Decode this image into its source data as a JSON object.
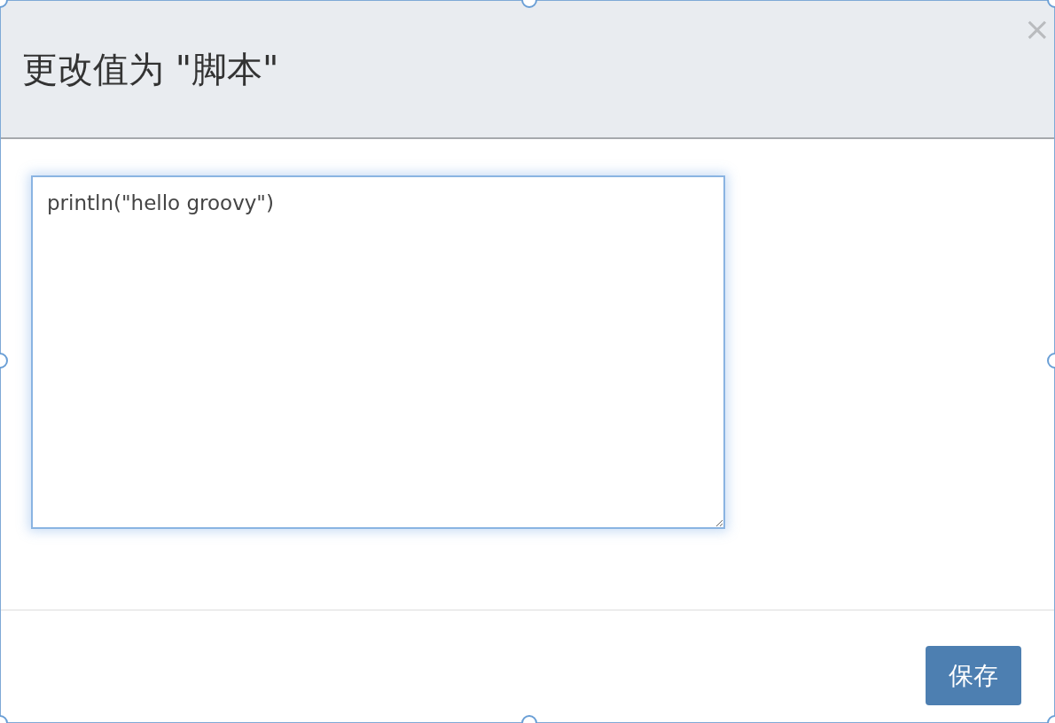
{
  "dialog": {
    "title": "更改值为 \"脚本\"",
    "close": "×",
    "script_field": {
      "value": "println(\"hello groovy\")",
      "focused": true
    },
    "buttons": [
      {
        "label": "保存"
      }
    ]
  }
}
